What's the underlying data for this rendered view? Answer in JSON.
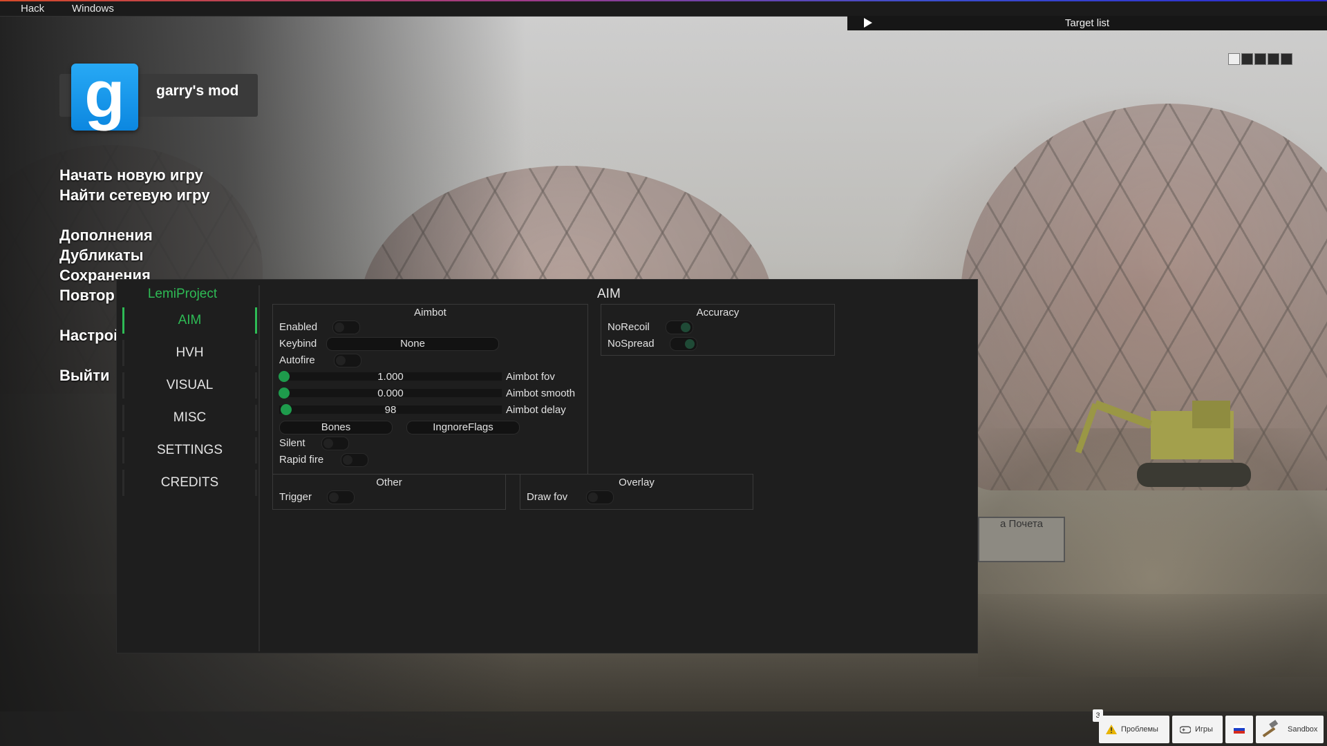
{
  "menubar": {
    "items": [
      "Hack",
      "Windows"
    ]
  },
  "target_list": {
    "title": "Target list"
  },
  "logo": {
    "letter": "g",
    "title": "garry's mod"
  },
  "main_menu": {
    "items": [
      "Начать новую игру",
      "Найти сетевую игру",
      "Дополнения",
      "Дубликаты",
      "Сохранения",
      "Повтор",
      "Настрой",
      "Выйти"
    ]
  },
  "background": {
    "sign_text": "а Почета"
  },
  "cheat": {
    "brand": "LemiProject",
    "tabs": [
      "AIM",
      "HVH",
      "VISUAL",
      "MISC",
      "SETTINGS",
      "CREDITS"
    ],
    "active_tab": "AIM",
    "content_title": "AIM",
    "aimbot": {
      "title": "Aimbot",
      "enabled_label": "Enabled",
      "keybind_label": "Keybind",
      "keybind_value": "None",
      "autofire_label": "Autofire",
      "fov_value": "1.000",
      "fov_label": "Aimbot fov",
      "smooth_value": "0.000",
      "smooth_label": "Aimbot smooth",
      "delay_value": "98",
      "delay_label": "Aimbot delay",
      "bones_label": "Bones",
      "ignore_flags_label": "IngnoreFlags",
      "silent_label": "Silent",
      "rapid_fire_label": "Rapid fire"
    },
    "accuracy": {
      "title": "Accuracy",
      "norecoil_label": "NoRecoil",
      "nospread_label": "NoSpread"
    },
    "other": {
      "title": "Other",
      "trigger_label": "Trigger"
    },
    "overlay": {
      "title": "Overlay",
      "draw_fov_label": "Draw fov"
    }
  },
  "taskbar": {
    "badge_count": "3",
    "problems_label": "Проблемы",
    "games_label": "Игры",
    "sandbox_label": "Sandbox"
  },
  "colors": {
    "accent": "#2ebb55",
    "logo_blue": "#1a9cf0"
  }
}
